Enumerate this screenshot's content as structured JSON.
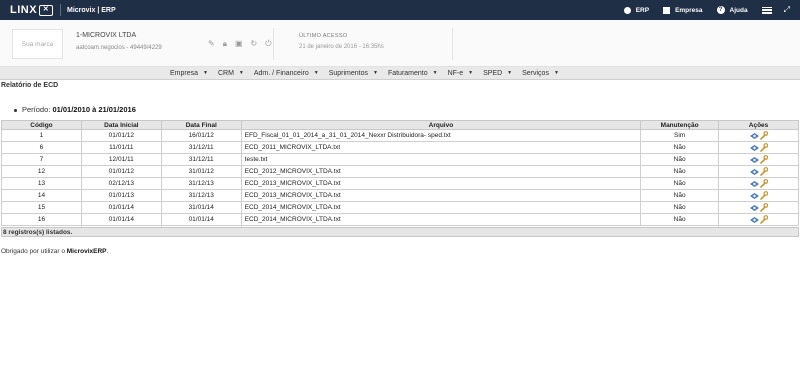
{
  "topbar": {
    "logo": "LINX",
    "app_title": "Microvix | ERP",
    "items": [
      {
        "label": "ERP",
        "icon": "globe-icon"
      },
      {
        "label": "Empresa",
        "icon": "building-icon"
      },
      {
        "label": "Ajuda",
        "icon": "help-icon"
      }
    ]
  },
  "header": {
    "brand_placeholder": "Sua marca",
    "company_name": "1-MICROVIX LTDA",
    "company_sub": "aatcoam.negocios - 49449/4229",
    "access_title": "ÚLTIMO ACESSO",
    "access_date": "21 de janeiro de 2016 - 16:35hs"
  },
  "menu": [
    "Empresa",
    "CRM",
    "Adm. / Financeiro",
    "Suprimentos",
    "Faturamento",
    "NF-e",
    "SPED",
    "Serviços"
  ],
  "report": {
    "title": "Relatório de ECD",
    "period_label": "Período:",
    "period_value": "01/01/2010 à 21/01/2016",
    "columns": [
      "Código",
      "Data Inicial",
      "Data Final",
      "Arquivo",
      "Manutenção",
      "Ações"
    ],
    "rows": [
      [
        "1",
        "01/01/12",
        "16/01/12",
        "EFD_Fiscal_01_01_2014_a_31_01_2014_Nexxr Distribuidora- sped.txt",
        "Sim"
      ],
      [
        "6",
        "11/01/11",
        "31/12/11",
        "ECD_2011_MICROVIX_LTDA.txt",
        "Não"
      ],
      [
        "7",
        "12/01/11",
        "31/12/11",
        "teste.txt",
        "Não"
      ],
      [
        "12",
        "01/01/12",
        "31/01/12",
        "ECD_2012_MICROVIX_LTDA.txt",
        "Não"
      ],
      [
        "13",
        "02/12/13",
        "31/12/13",
        "ECD_2013_MICROVIX_LTDA.txt",
        "Não"
      ],
      [
        "14",
        "01/01/13",
        "31/12/13",
        "ECD_2013_MICROVIX_LTDA.txt",
        "Não"
      ],
      [
        "15",
        "01/01/14",
        "31/01/14",
        "ECD_2014_MICROVIX_LTDA.txt",
        "Não"
      ],
      [
        "16",
        "01/01/14",
        "01/01/14",
        "ECD_2014_MICROVIX_LTDA.txt",
        "Não"
      ]
    ],
    "records_label": "8 registros(s) listados.",
    "thanks_prefix": "Obrigado por utilizar o ",
    "thanks_brand": "MicrovixERP",
    "thanks_suffix": "."
  }
}
